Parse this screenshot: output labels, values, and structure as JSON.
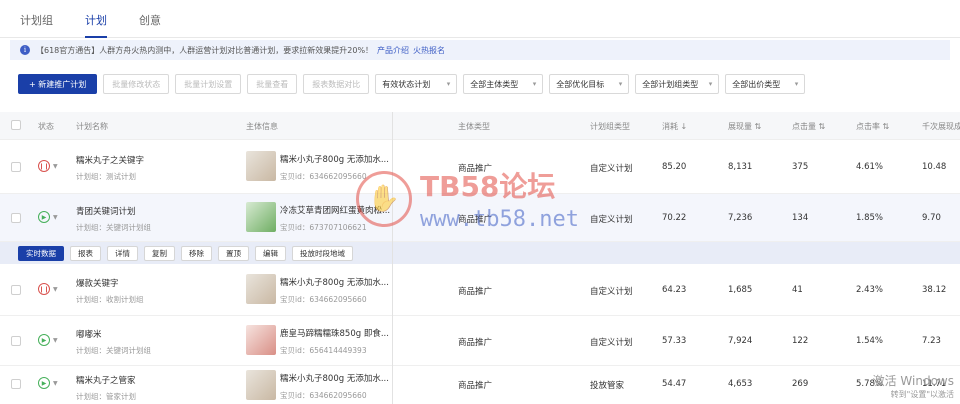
{
  "tabs": [
    {
      "label": "计划组",
      "active": false
    },
    {
      "label": "计划",
      "active": true
    },
    {
      "label": "创意",
      "active": false
    }
  ],
  "notice": {
    "text": "【618官方通告】人群方舟火热内测中，人群运营计划对比普通计划，要求拉新效果提升20%！",
    "link1": "产品介绍",
    "link2": "火热报名"
  },
  "toolbar": {
    "new_plan": "+ 新建推广计划",
    "batch_status": "批量修改状态",
    "batch_settings": "批量计划设置",
    "batch_view": "批量查看",
    "report_compare": "报表数据对比",
    "filters": [
      "有效状态计划",
      "全部主体类型",
      "全部优化目标",
      "全部计划组类型",
      "全部出价类型"
    ]
  },
  "table": {
    "headers": [
      "状态",
      "计划名称",
      "主体信息",
      "主体类型",
      "计划组类型",
      "消耗 ↓",
      "展现量 ⇅",
      "点击量 ⇅",
      "点击率 ⇅",
      "千次展现成"
    ],
    "rows": [
      {
        "status": "paused",
        "name": "糯米丸子之关键字",
        "group": "计划组：测试计划",
        "product": "糯米小丸子800g 无添加水...",
        "product_id": "宝贝id：634662095660",
        "ptype": "商品推广",
        "gtype": "自定义计划",
        "cost": "85.20",
        "impressions": "8,131",
        "clicks": "375",
        "ctr": "4.61%",
        "cpm": "10.48"
      },
      {
        "status": "running",
        "name": "青团关键词计划",
        "group": "计划组：关键词计划组",
        "product": "冷冻艾草青团网红蛋黄肉松...",
        "product_id": "宝贝id：673707106621",
        "ptype": "商品推广",
        "gtype": "自定义计划",
        "cost": "70.22",
        "impressions": "7,236",
        "clicks": "134",
        "ctr": "1.85%",
        "cpm": "9.70"
      },
      {
        "status": "paused",
        "name": "爆款关键字",
        "group": "计划组：收割计划组",
        "product": "糯米小丸子800g 无添加水...",
        "product_id": "宝贝id：634662095660",
        "ptype": "商品推广",
        "gtype": "自定义计划",
        "cost": "64.23",
        "impressions": "1,685",
        "clicks": "41",
        "ctr": "2.43%",
        "cpm": "38.12"
      },
      {
        "status": "running",
        "name": "嘟嘟米",
        "group": "计划组：关键词计划组",
        "product": "鹿皇马蹄糯糯珠850g 即食...",
        "product_id": "宝贝id：656414449393",
        "ptype": "商品推广",
        "gtype": "自定义计划",
        "cost": "57.33",
        "impressions": "7,924",
        "clicks": "122",
        "ctr": "1.54%",
        "cpm": "7.23"
      },
      {
        "status": "running",
        "name": "糯米丸子之管家",
        "group": "计划组：管家计划",
        "product": "糯米小丸子800g 无添加水...",
        "product_id": "宝贝id：634662095660",
        "ptype": "商品推广",
        "gtype": "投放管家",
        "cost": "54.47",
        "impressions": "4,653",
        "clicks": "269",
        "ctr": "5.78%",
        "cpm": "11.71"
      }
    ]
  },
  "row_actions": [
    "实时数据",
    "报表",
    "详情",
    "复制",
    "移除",
    "置顶",
    "编辑",
    "投放时段地域"
  ],
  "watermark": {
    "title": "TB58论坛",
    "url": "www.tb58.net"
  },
  "os_notice": {
    "line1": "激活 Windows",
    "line2": "转到\"设置\"以激活"
  },
  "colors": {
    "brand": "#1a3fa8",
    "paused": "#d9534f",
    "running": "#46b05a"
  }
}
